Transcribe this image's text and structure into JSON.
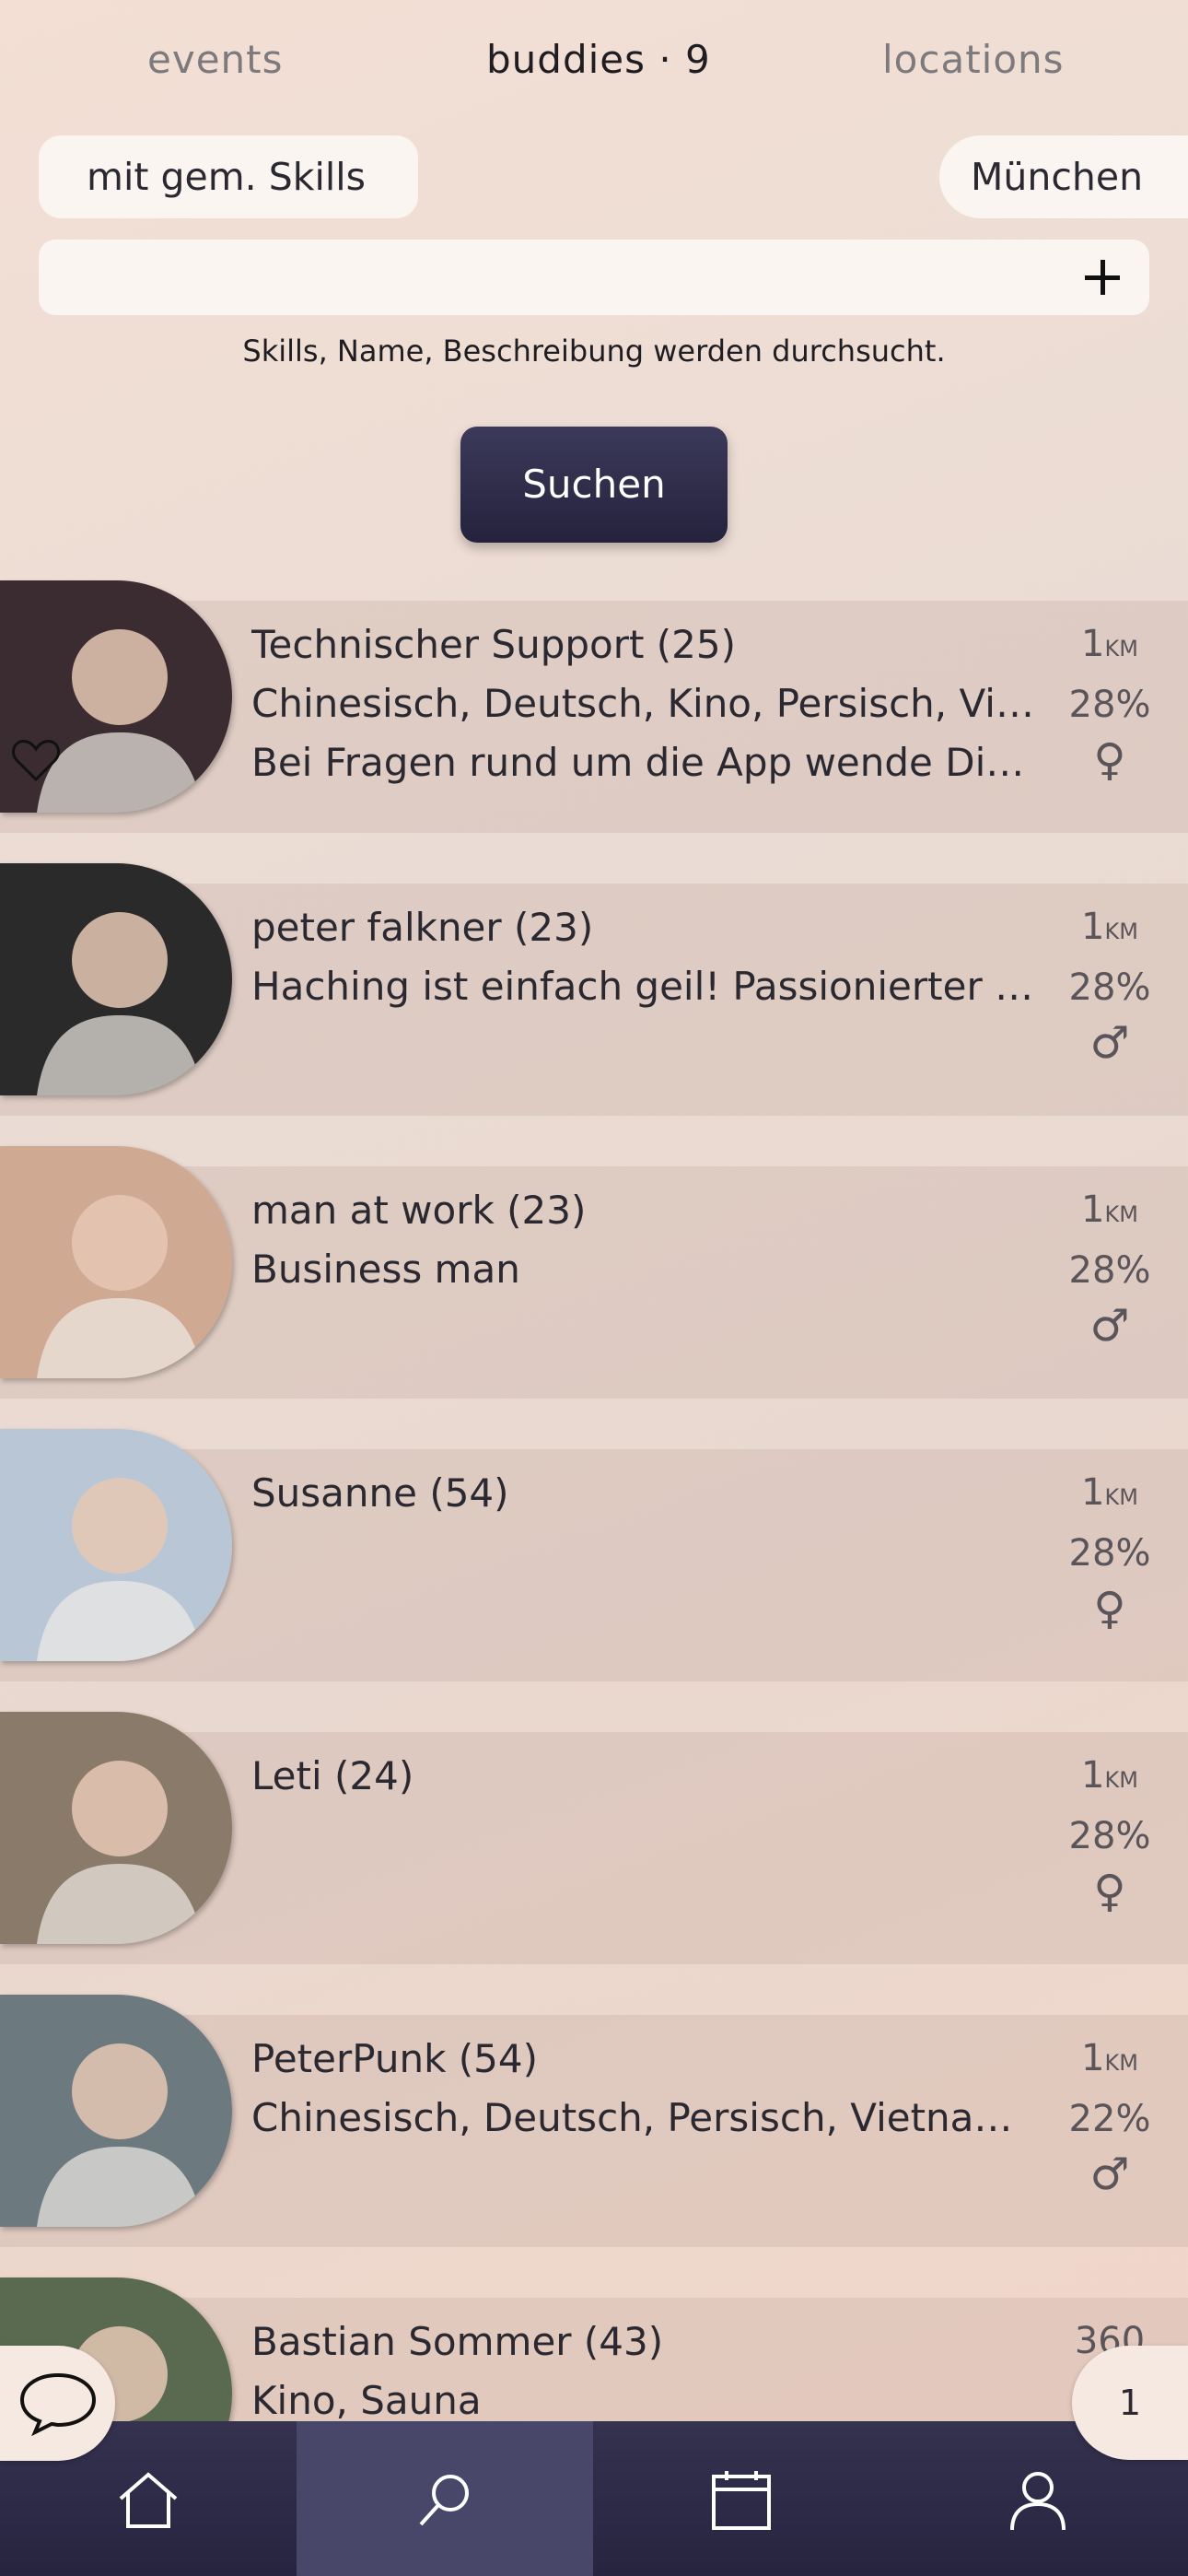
{
  "tabs": [
    {
      "label": "events",
      "active": false
    },
    {
      "label": "buddies · 9",
      "active": true
    },
    {
      "label": "locations",
      "active": false
    }
  ],
  "filters": {
    "skills_chip": "mit gem. Skills",
    "city_chip": "München",
    "search_placeholder": "",
    "hint": "Skills, Name, Beschreibung werden durchsucht.",
    "search_button": "Suchen"
  },
  "buddies": [
    {
      "title": "Technischer Support (25)",
      "line2": "Chinesisch, Deutsch, Kino, Persisch, Vietnamesisch",
      "line3": "Bei Fragen rund um die App wende Dich an mich",
      "distance": "1",
      "unit": "KM",
      "match": "28%",
      "gender": "♀",
      "favorite": true,
      "avatar_color": "#3a2c30"
    },
    {
      "title": "peter falkner (23)",
      "line2": "Haching ist einfach geil! Passionierter Skifahrer",
      "line3": "",
      "distance": "1",
      "unit": "KM",
      "match": "28%",
      "gender": "♂",
      "favorite": false,
      "avatar_color": "#2a2a2a"
    },
    {
      "title": "man at work (23)",
      "line2": "Business man",
      "line3": "",
      "distance": "1",
      "unit": "KM",
      "match": "28%",
      "gender": "♂",
      "favorite": false,
      "avatar_color": "#cfa992"
    },
    {
      "title": "Susanne (54)",
      "line2": "",
      "line3": "",
      "distance": "1",
      "unit": "KM",
      "match": "28%",
      "gender": "♀",
      "favorite": false,
      "avatar_color": "#b9c6d6"
    },
    {
      "title": "Leti (24)",
      "line2": "",
      "line3": "",
      "distance": "1",
      "unit": "KM",
      "match": "28%",
      "gender": "♀",
      "favorite": false,
      "avatar_color": "#8a7a6a"
    },
    {
      "title": "PeterPunk (54)",
      "line2": "Chinesisch, Deutsch, Persisch, Vietnamesisch",
      "line3": "",
      "distance": "1",
      "unit": "KM",
      "match": "22%",
      "gender": "♂",
      "favorite": false,
      "avatar_color": "#6c7a80"
    },
    {
      "title": "Bastian Sommer (43)",
      "line2": "Kino, Sauna",
      "line3": "",
      "distance": "360",
      "unit": "",
      "match": "",
      "gender": "",
      "favorite": false,
      "avatar_color": "#5a6a50"
    }
  ],
  "chat_badge": "1",
  "nav": [
    "home-icon",
    "search-icon",
    "calendar-icon",
    "user-icon"
  ]
}
